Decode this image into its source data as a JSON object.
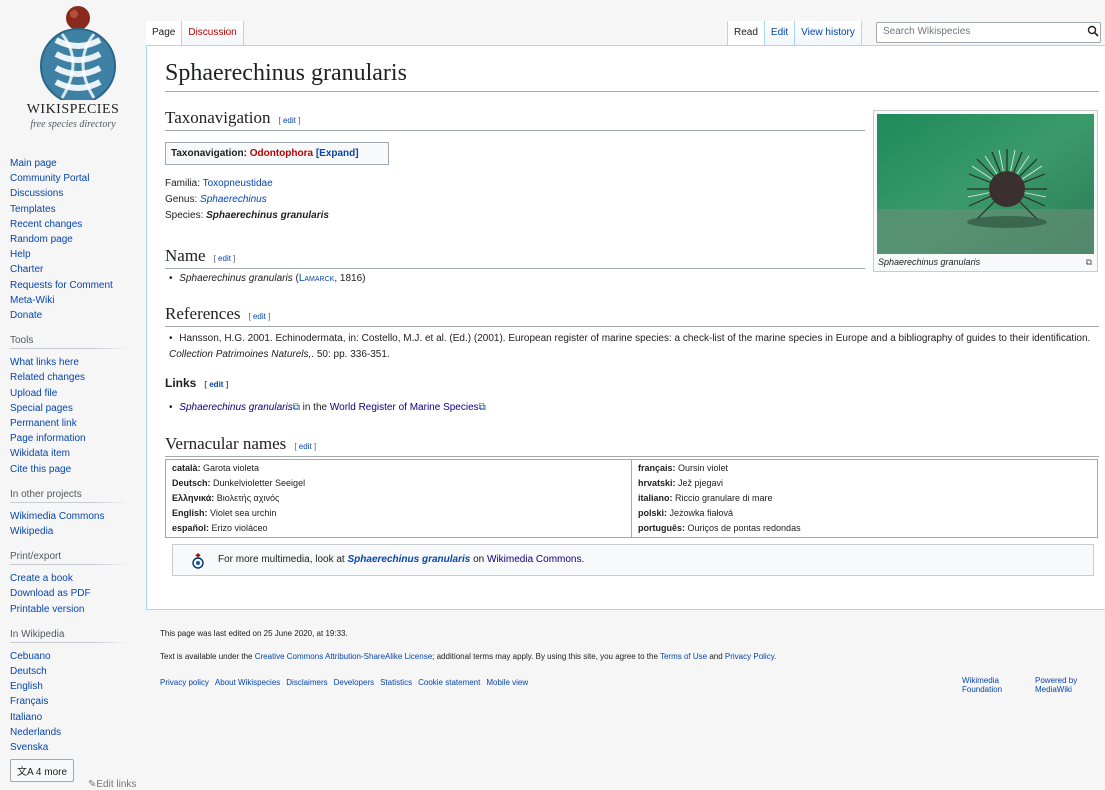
{
  "logo": {
    "title": "WIKISPECIES",
    "tagline": "free species directory"
  },
  "sidebar": {
    "nav": [
      "Main page",
      "Community Portal",
      "Discussions",
      "Templates",
      "Recent changes",
      "Random page",
      "Help",
      "Charter",
      "Requests for Comment",
      "Meta-Wiki",
      "Donate"
    ],
    "tools_heading": "Tools",
    "tools": [
      "What links here",
      "Related changes",
      "Upload file",
      "Special pages",
      "Permanent link",
      "Page information",
      "Wikidata item",
      "Cite this page"
    ],
    "projects_heading": "In other projects",
    "projects": [
      "Wikimedia Commons",
      "Wikipedia"
    ],
    "print_heading": "Print/export",
    "print": [
      "Create a book",
      "Download as PDF",
      "Printable version"
    ],
    "lang_heading": "In Wikipedia",
    "langs": [
      "Cebuano",
      "Deutsch",
      "English",
      "Français",
      "Italiano",
      "Nederlands",
      "Svenska"
    ],
    "more_langs": "4 more",
    "edit_links": "Edit links"
  },
  "tabs": {
    "page": "Page",
    "discussion": "Discussion",
    "read": "Read",
    "edit": "Edit",
    "history": "View history"
  },
  "search": {
    "placeholder": "Search Wikispecies"
  },
  "article": {
    "title": "Sphaerechinus granularis",
    "edit": "edit",
    "taxo_heading": "Taxonavigation",
    "taxo_box_label": "Taxonavigation:",
    "taxo_box_link": "Odontophora",
    "taxo_box_expand": "[Expand]",
    "familia_label": "Familia:",
    "familia": "Toxopneustidae",
    "genus_label": "Genus:",
    "genus": "Sphaerechinus",
    "species_label": "Species:",
    "species": "Sphaerechinus granularis",
    "name_heading": "Name",
    "name_taxon": "Sphaerechinus granularis",
    "name_open": " (",
    "name_author": "Lamarck",
    "name_year": ", 1816)",
    "refs_heading": "References",
    "ref_text": "Hansson, H.G. 2001. Echinodermata, in: Costello, M.J. et al. (Ed.) (2001). European register of marine species: a check-list of the marine species in Europe and a bibliography of guides to their identification.",
    "ref_italic": "Collection Patrimoines Naturels,",
    "ref_end": ". 50: pp. 336-351.",
    "links_heading": "Links",
    "link1": "Sphaerechinus granularis",
    "link_in_the": " in the ",
    "link2": "World Register of Marine Species",
    "vern_heading": "Vernacular names",
    "vern_left": [
      {
        "lang": "català:",
        "name": "Garota violeta"
      },
      {
        "lang": "Deutsch:",
        "name": "Dunkelvioletter Seeigel"
      },
      {
        "lang": "Ελληνικά:",
        "name": "Βιολετής αχινός"
      },
      {
        "lang": "English:",
        "name": "Violet sea urchin"
      },
      {
        "lang": "español:",
        "name": "Erizo violáceo"
      }
    ],
    "vern_right": [
      {
        "lang": "français:",
        "name": "Oursin violet"
      },
      {
        "lang": "hrvatski:",
        "name": "Jež pjegavi"
      },
      {
        "lang": "italiano:",
        "name": "Riccio granulare di mare"
      },
      {
        "lang": "polski:",
        "name": "Jeżowka fiałová"
      },
      {
        "lang": "português:",
        "name": "Ouriços de pontas redondas"
      }
    ],
    "commons_pre": "For more multimedia, look at ",
    "commons_link": "Sphaerechinus granularis",
    "commons_post": " on ",
    "commons_site": "Wikimedia Commons.",
    "thumb_caption": "Sphaerechinus granularis"
  },
  "footer": {
    "last_edited": "This page was last edited on 25 June 2020, at 19:33.",
    "license_pre": "Text is available under the ",
    "license_link": "Creative Commons Attribution-ShareAlike License",
    "license_mid": "; additional terms may apply. By using this site, you agree to the ",
    "terms_link": "Terms of Use",
    "and": " and ",
    "privacy_link": "Privacy Policy.",
    "links": [
      "Privacy policy",
      "About Wikispecies",
      "Disclaimers",
      "Developers",
      "Statistics",
      "Cookie statement",
      "Mobile view"
    ],
    "wikimedia": "Wikimedia Foundation",
    "powered": "Powered by MediaWiki"
  },
  "colors": {
    "link": "#0645ad",
    "redlink": "#ba0000",
    "visited": "#0b0080",
    "border": "#a7d7f9"
  }
}
